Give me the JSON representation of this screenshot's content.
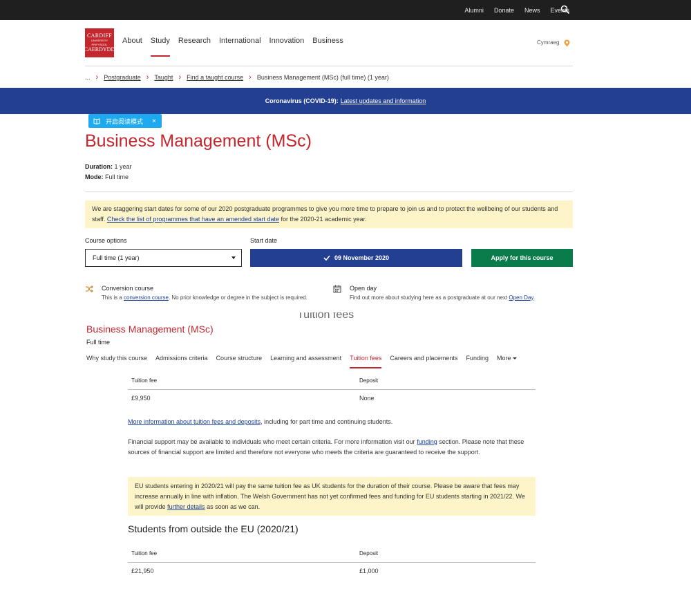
{
  "utility": {
    "links": [
      "Alumni",
      "Donate",
      "News",
      "Events"
    ]
  },
  "logo": {
    "line1": "CARDIFF",
    "line2": "UNIVERSITY",
    "line3": "PRIFYSGOL",
    "line4": "CAERDYDD"
  },
  "nav": {
    "items": [
      "About",
      "Study",
      "Research",
      "International",
      "Innovation",
      "Business"
    ],
    "active": "Study",
    "language": "Cymraeg"
  },
  "breadcrumb": {
    "ellipsis": "...",
    "items": [
      "Postgraduate",
      "Taught",
      "Find a taught course"
    ],
    "current": "Business Management (MSc) (full time) (1 year)"
  },
  "covid": {
    "label": "Coronavirus (COVID-19):",
    "link": "Latest updates and information"
  },
  "reader": {
    "label": "开启阅读模式",
    "close": "×"
  },
  "course": {
    "title": "Business Management (MSc)",
    "duration_label": "Duration:",
    "duration_value": "1 year",
    "mode_label": "Mode:",
    "mode_value": "Full time"
  },
  "notice": {
    "text1": "We are staggering start dates for some of our 2020 postgraduate programmes to give you more time to prepare to join us and to protect the wellbeing of our students and staff. ",
    "link": "Check the list of programmes that have an amended start date",
    "text2": " for the 2020-21 academic year."
  },
  "options": {
    "course_options_label": "Course options",
    "course_option_value": "Full time (1 year)",
    "start_date_label": "Start date",
    "start_date_value": "09 November 2020",
    "apply_label": "Apply for this course"
  },
  "features": {
    "conversion": {
      "title": "Conversion course",
      "desc1": "This is a ",
      "link": "conversion course",
      "desc2": ". No prior knowledge or degree in the subject is required."
    },
    "openday": {
      "title": "Open day",
      "desc1": "Find out more about studying here as a postgraduate at our next ",
      "link": "Open Day",
      "desc2": "."
    }
  },
  "section": {
    "ghost_heading": "Tuition fees",
    "title": "Business Management (MSc)",
    "mode": "Full time",
    "tabs": [
      "Why study this course",
      "Admissions criteria",
      "Course structure",
      "Learning and assessment",
      "Tuition fees",
      "Careers and placements",
      "Funding"
    ],
    "active_tab": "Tuition fees",
    "more": "More"
  },
  "fees_uk": {
    "fee_header": "Tuition fee",
    "deposit_header": "Deposit",
    "fee_value": "£9,950",
    "deposit_value": "None"
  },
  "more_info": {
    "link": "More information about tuition fees and deposits",
    "text": ", including for part time and continuing students."
  },
  "financial": {
    "text1": "Financial support may be available to individuals who meet certain criteria. For more information visit our ",
    "link": "funding",
    "text2": " section. Please note that these sources of financial support are limited and therefore not everyone who meets the criteria are guaranteed to receive the support."
  },
  "eu_notice": {
    "text1": "EU students entering in 2020/21 will pay the same tuition fee as UK students for the duration of their course. Please be aware that fees may increase annually in line with inflation. The Welsh Government has not yet confirmed fees and funding for EU students starting in 2021/22. We will provide ",
    "link": "further details",
    "text2": " as soon as we can."
  },
  "fees_outside": {
    "title": "Students from outside the EU (2020/21)",
    "fee_header": "Tuition fee",
    "deposit_header": "Deposit",
    "fee_value": "£21,950",
    "deposit_value": "£1,000"
  },
  "colors": {
    "brand_red": "#c4262e",
    "covid_blue": "#233f91",
    "apply_green": "#0a7b4a",
    "notice_yellow": "#fdf4c9",
    "reader_blue": "#1eaaf1"
  }
}
